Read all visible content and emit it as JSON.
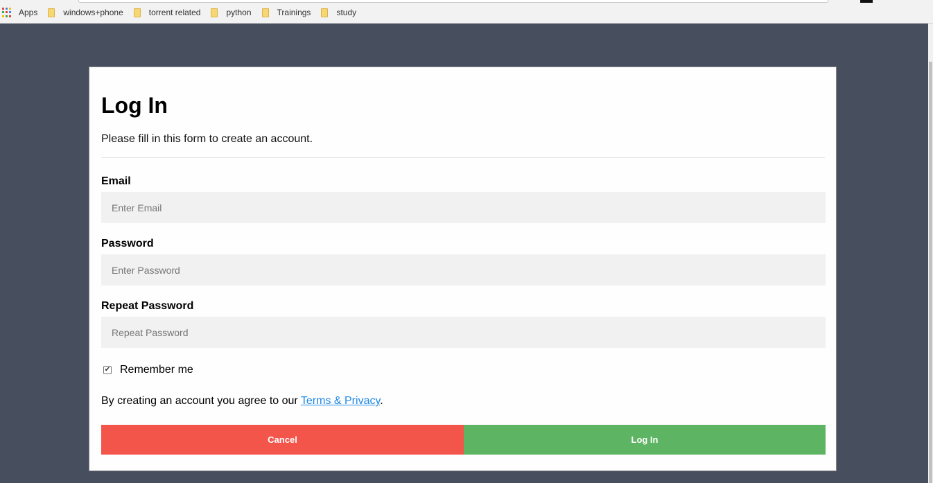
{
  "browser": {
    "bookmarks": [
      {
        "label": "Apps",
        "icon": "apps-grid-icon"
      },
      {
        "label": "windows+phone",
        "icon": "folder-icon"
      },
      {
        "label": "torrent related",
        "icon": "folder-icon"
      },
      {
        "label": "python",
        "icon": "folder-icon"
      },
      {
        "label": "Trainings",
        "icon": "folder-icon"
      },
      {
        "label": "study",
        "icon": "folder-icon"
      }
    ]
  },
  "form": {
    "title": "Log In",
    "subtitle": "Please fill in this form to create an account.",
    "email_label": "Email",
    "email_placeholder": "Enter Email",
    "password_label": "Password",
    "password_placeholder": "Enter Password",
    "repeat_label": "Repeat Password",
    "repeat_placeholder": "Repeat Password",
    "remember_label": "Remember me",
    "remember_checked": true,
    "terms_prefix": "By creating an account you agree to our ",
    "terms_link": "Terms & Privacy",
    "terms_suffix": ".",
    "cancel_label": "Cancel",
    "login_label": "Log In"
  },
  "colors": {
    "page_background": "#474e5d",
    "cancel_button": "#f4554b",
    "login_button": "#5db462",
    "link": "#1e88e5",
    "input_background": "#f1f1f1"
  }
}
